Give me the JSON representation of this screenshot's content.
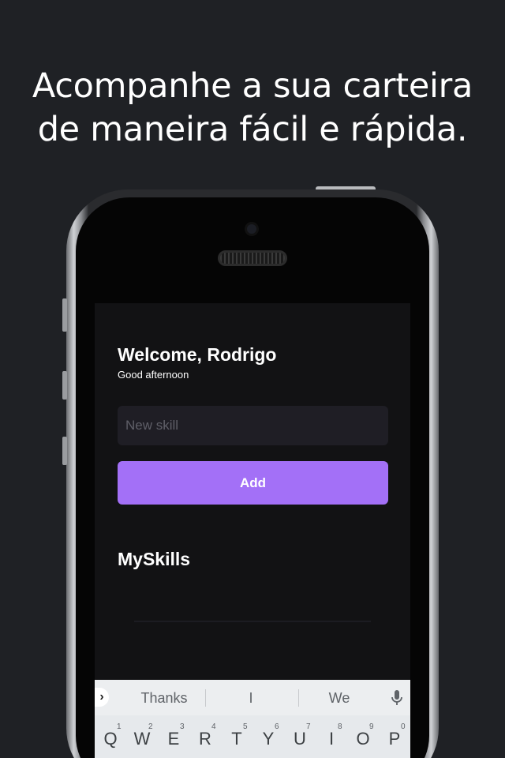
{
  "headline": {
    "line1": "Acompanhe a sua carteira",
    "line2": "de maneira fácil e rápida."
  },
  "app": {
    "welcome": "Welcome, Rodrigo",
    "greeting": "Good afternoon",
    "input_placeholder": "New skill",
    "add_label": "Add",
    "section_title": "MySkills"
  },
  "keyboard": {
    "expand_icon": "chevron-right-icon",
    "expand_glyph": "›",
    "suggestions": [
      "Thanks",
      "I",
      "We"
    ],
    "mic_icon": "mic-icon",
    "keys": [
      "Q",
      "W",
      "E",
      "R",
      "T",
      "Y",
      "U",
      "I",
      "O",
      "P"
    ],
    "numbers": [
      "1",
      "2",
      "3",
      "4",
      "5",
      "6",
      "7",
      "8",
      "9",
      "0"
    ]
  },
  "colors": {
    "background": "#1f2125",
    "screen": "#121214",
    "input": "#1f1e25",
    "accent": "#a370f7"
  }
}
